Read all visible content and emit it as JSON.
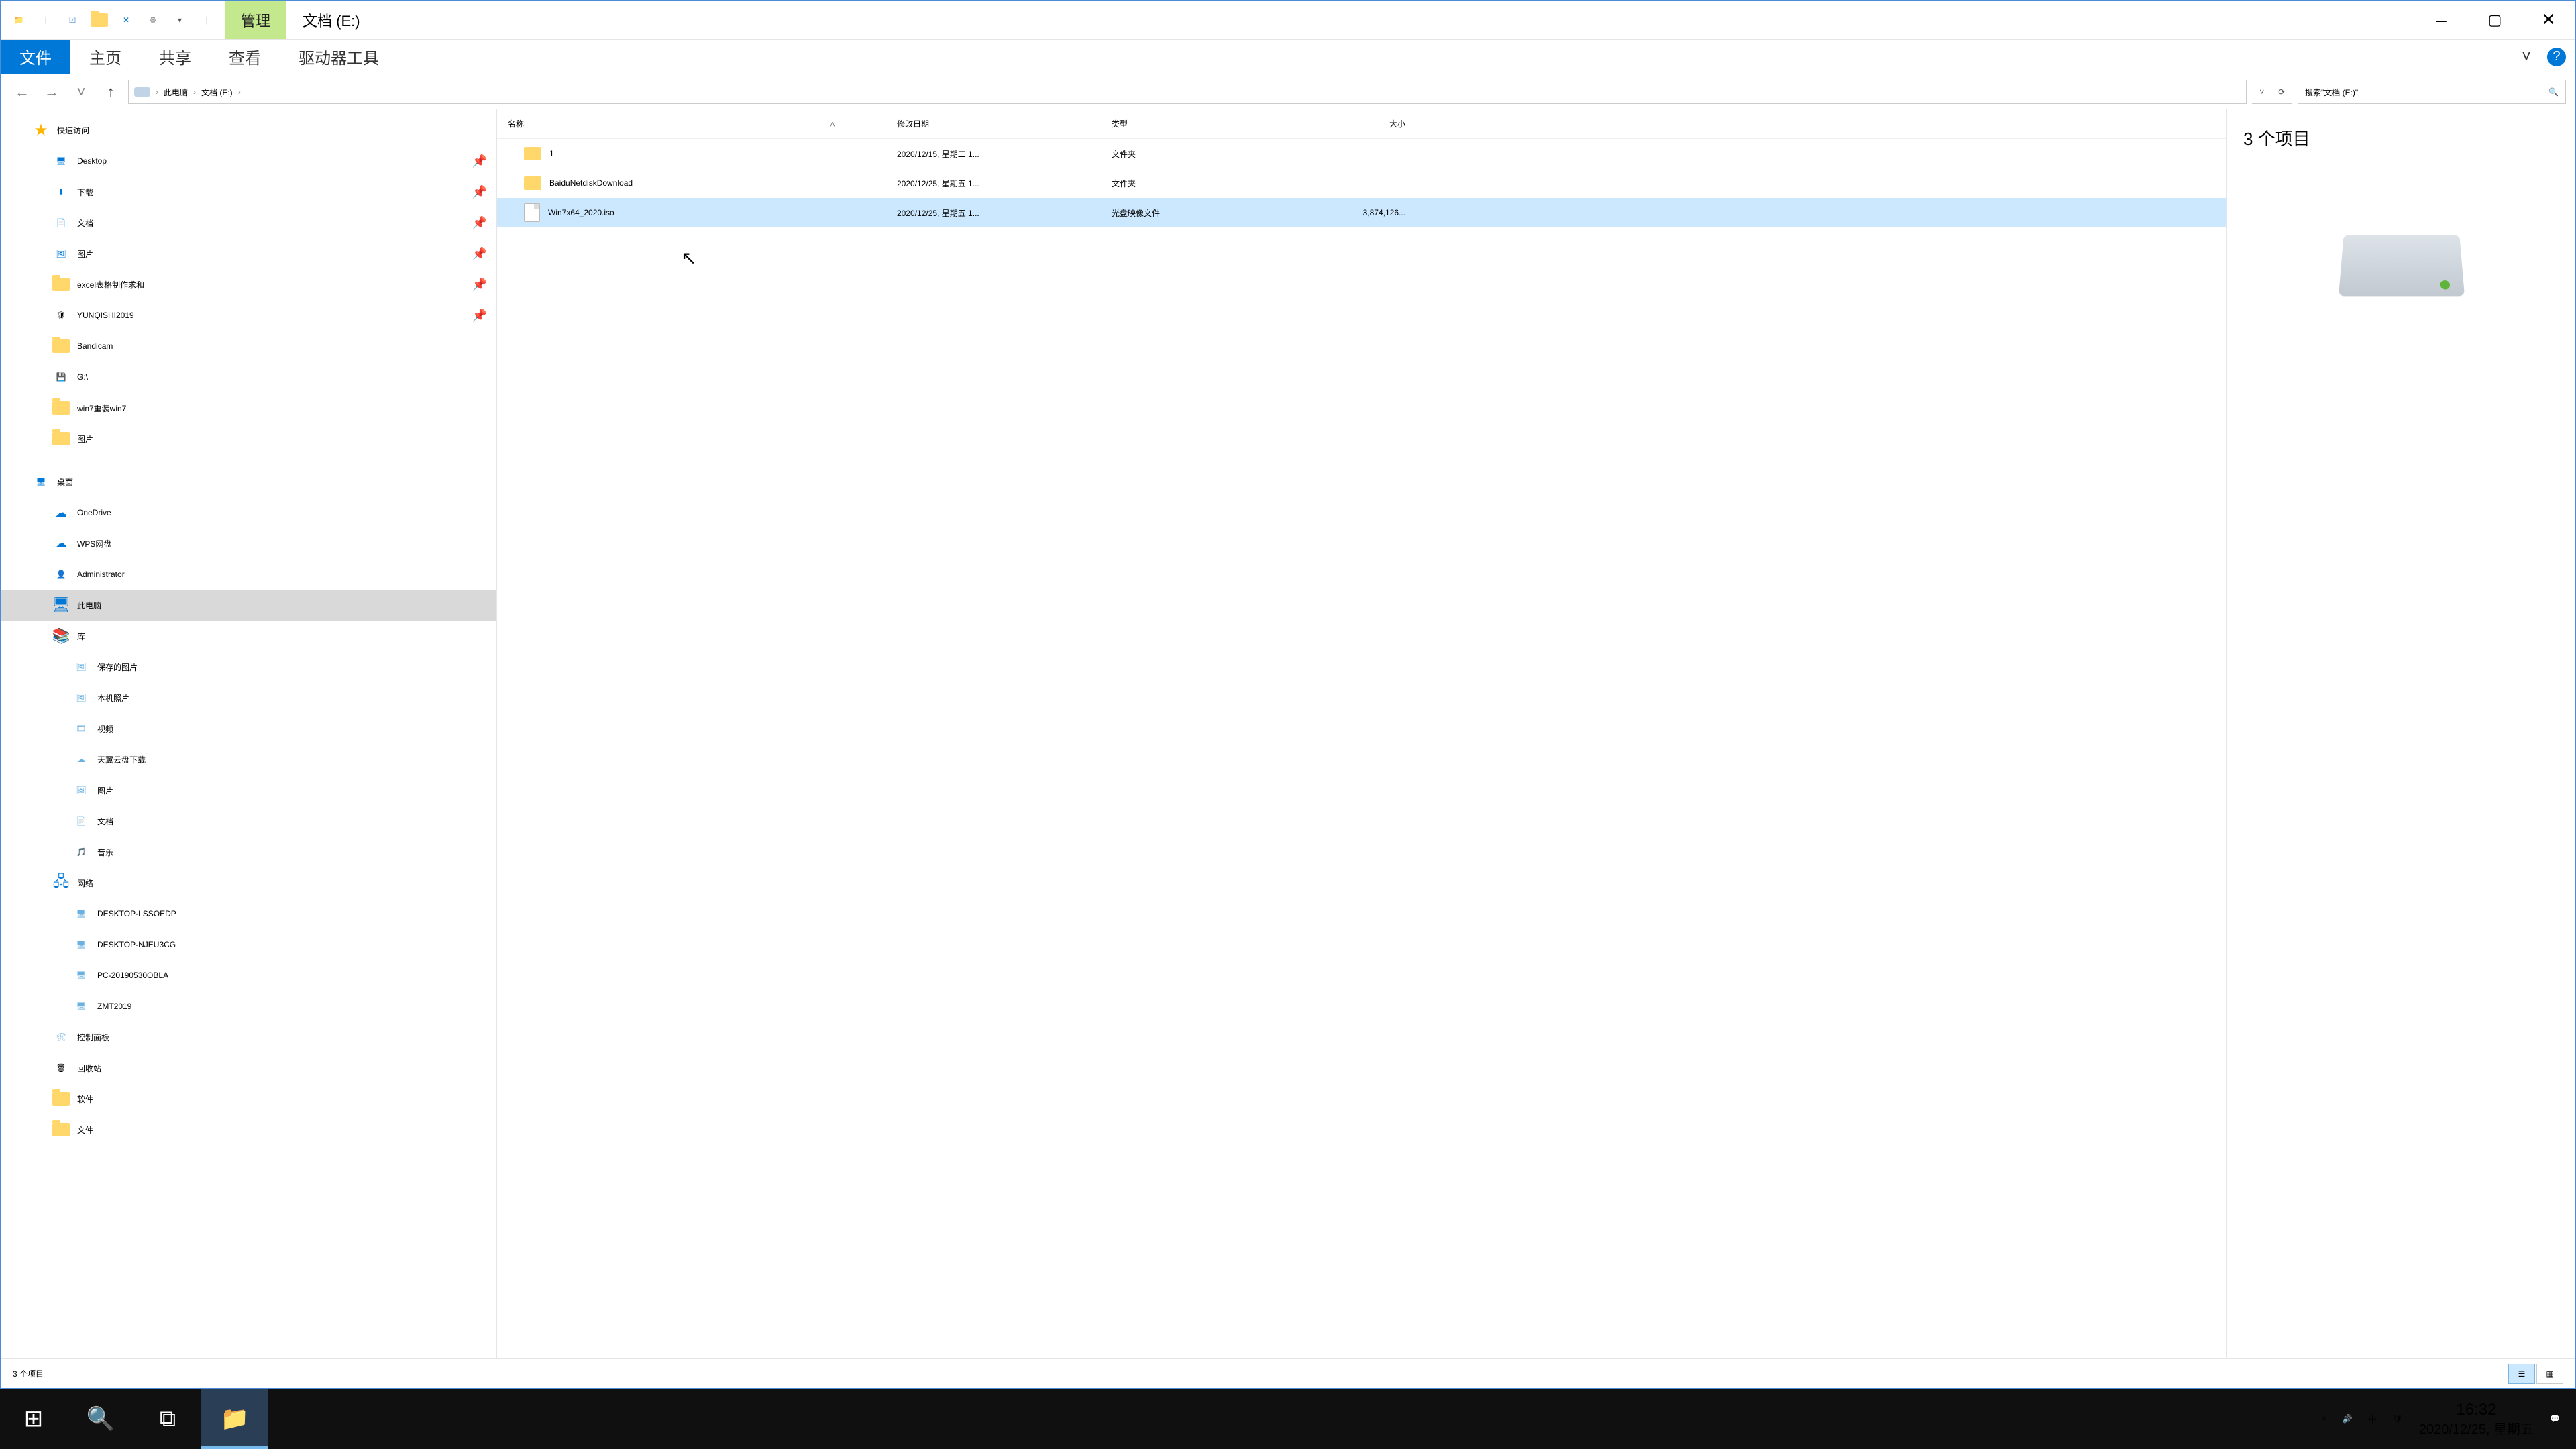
{
  "titlebar": {
    "management": "管理",
    "location": "文档 (E:)"
  },
  "ribbon": {
    "file": "文件",
    "home": "主页",
    "share": "共享",
    "view": "查看",
    "drive_tools": "驱动器工具",
    "expand": "˅",
    "help": "?"
  },
  "address": {
    "root": "此电脑",
    "path": "文档 (E:)",
    "search_placeholder": "搜索\"文档 (E:)\""
  },
  "nav": {
    "quick_access": "快速访问",
    "desktop": "Desktop",
    "downloads": "下载",
    "documents": "文档",
    "pictures": "图片",
    "excel": "excel表格制作求和",
    "yunqishi": "YUNQISHI2019",
    "bandicam": "Bandicam",
    "gdrive": "G:\\",
    "win7": "win7重装win7",
    "pictures2": "图片",
    "desktop_root": "桌面",
    "onedrive": "OneDrive",
    "wps": "WPS网盘",
    "admin": "Administrator",
    "this_pc": "此电脑",
    "libraries": "库",
    "saved_pics": "保存的图片",
    "camera_roll": "本机照片",
    "video": "视频",
    "tianyi": "天翼云盘下载",
    "pictures3": "图片",
    "documents2": "文档",
    "music": "音乐",
    "network": "网络",
    "net1": "DESKTOP-LSSOEDP",
    "net2": "DESKTOP-NJEU3CG",
    "net3": "PC-20190530OBLA",
    "net4": "ZMT2019",
    "control_panel": "控制面板",
    "recycle": "回收站",
    "software": "软件",
    "documents3": "文件"
  },
  "columns": {
    "name": "名称",
    "date": "修改日期",
    "type": "类型",
    "size": "大小"
  },
  "rows": [
    {
      "name": "1",
      "date": "2020/12/15, 星期二 1...",
      "type": "文件夹",
      "size": "",
      "icon": "folder"
    },
    {
      "name": "BaiduNetdiskDownload",
      "date": "2020/12/25, 星期五 1...",
      "type": "文件夹",
      "size": "",
      "icon": "folder"
    },
    {
      "name": "Win7x64_2020.iso",
      "date": "2020/12/25, 星期五 1...",
      "type": "光盘映像文件",
      "size": "3,874,126...",
      "icon": "file"
    }
  ],
  "preview": {
    "count": "3 个项目"
  },
  "status": {
    "items": "3 个项目"
  },
  "tray": {
    "ime": "中",
    "time": "16:32",
    "date": "2020/12/25, 星期五"
  }
}
